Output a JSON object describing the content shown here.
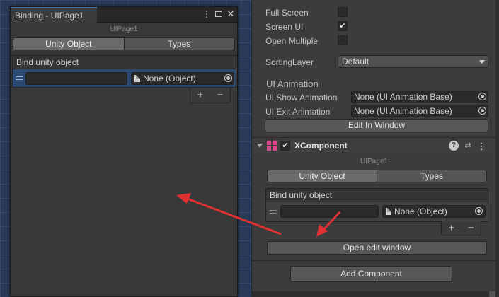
{
  "binding_window": {
    "tab_title": "Binding - UIPage1",
    "page_caption": "UIPage1",
    "tabs": [
      {
        "label": "Unity Object"
      },
      {
        "label": "Types"
      }
    ],
    "list_header": "Bind unity object",
    "object_field_value": "None (Object)",
    "add_symbol": "+",
    "remove_symbol": "−"
  },
  "inspector": {
    "full_screen_label": "Full Screen",
    "screen_ui_label": "Screen UI",
    "screen_ui_checked": "✔",
    "open_multiple_label": "Open Multiple",
    "sorting_layer_label": "SortingLayer",
    "sorting_layer_value": "Default",
    "ui_animation_title": "UI Animation",
    "show_anim_label": "UI Show Animation",
    "show_anim_value": "None (UI Animation Base)",
    "exit_anim_label": "UI Exit Animation",
    "exit_anim_value": "None (UI Animation Base)",
    "edit_in_window_button": "Edit In Window",
    "component": {
      "enabled_check": "✔",
      "title": "XComponent",
      "help_icon": "?",
      "settings_icon": "⇄",
      "menu_icon": "⋮",
      "page_caption": "UIPage1",
      "tabs": [
        {
          "label": "Unity Object"
        },
        {
          "label": "Types"
        }
      ],
      "list_header": "Bind unity object",
      "object_field_value": "None (Object)",
      "add_symbol": "+",
      "remove_symbol": "−",
      "open_edit_window_button": "Open edit window"
    },
    "add_component_button": "Add Component"
  },
  "colors": {
    "accent": "#3a79bb",
    "arrow": "#e03232",
    "component_icon": "#e0488e"
  }
}
